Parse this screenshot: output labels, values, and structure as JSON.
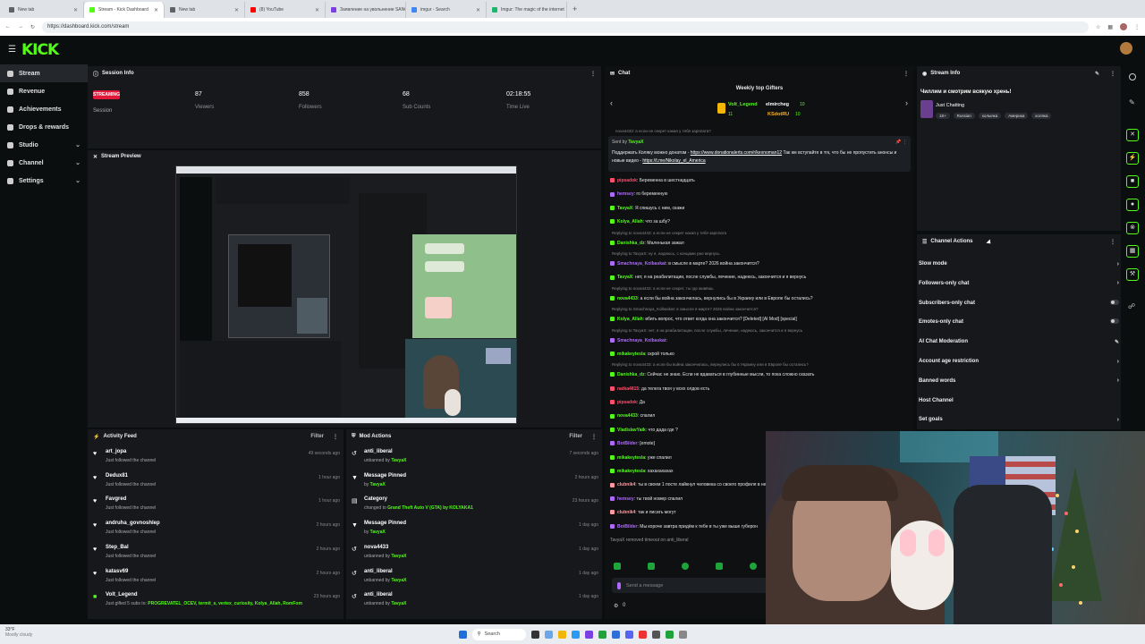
{
  "browser": {
    "tabs": [
      {
        "title": "New tab",
        "color": "#5f6368"
      },
      {
        "title": "Stream - Kick Dashboard",
        "color": "#53fc18",
        "active": true
      },
      {
        "title": "New tab",
        "color": "#5f6368"
      },
      {
        "title": "(8) YouTube",
        "color": "#ff0000"
      },
      {
        "title": "Заявление на увольнение SANG",
        "color": "#7b3fe4"
      },
      {
        "title": "imgur - Search",
        "color": "#4285f4"
      },
      {
        "title": "Imgur: The magic of the internet",
        "color": "#1bb76e"
      }
    ],
    "url": "https://dashboard.kick.com/stream"
  },
  "sidebar": {
    "items": [
      {
        "label": "Stream",
        "active": true
      },
      {
        "label": "Revenue"
      },
      {
        "label": "Achievements"
      },
      {
        "label": "Drops & rewards"
      },
      {
        "label": "Studio",
        "chevron": true
      },
      {
        "label": "Channel",
        "chevron": true
      },
      {
        "label": "Settings",
        "chevron": true
      }
    ]
  },
  "session": {
    "title": "Session Info",
    "streaming_badge": "STREAMING",
    "session_label": "Session",
    "stats": [
      {
        "value": "87",
        "label": "Viewers"
      },
      {
        "value": "858",
        "label": "Followers"
      },
      {
        "value": "68",
        "label": "Sub Counts"
      },
      {
        "value": "02:18:55",
        "label": "Time Live"
      }
    ]
  },
  "preview": {
    "title": "Stream Preview"
  },
  "activity": {
    "title": "Activity Feed",
    "filter": "Filter",
    "items": [
      {
        "name": "art_jopa",
        "sub": "Just followed the channel",
        "time": "49 seconds ago",
        "icon": "heart"
      },
      {
        "name": "Dedux81",
        "sub": "Just followed the channel",
        "time": "1 hour ago",
        "icon": "heart"
      },
      {
        "name": "Favgred",
        "sub": "Just followed the channel",
        "time": "1 hour ago",
        "icon": "heart"
      },
      {
        "name": "andruha_govnoshlep",
        "sub": "Just followed the channel",
        "time": "2 hours ago",
        "icon": "heart"
      },
      {
        "name": "Step_Bal",
        "sub": "Just followed the channel",
        "time": "2 hours ago",
        "icon": "heart"
      },
      {
        "name": "katasv69",
        "sub": "Just followed the channel",
        "time": "2 hours ago",
        "icon": "heart"
      },
      {
        "name": "Volt_Legend",
        "sub_prefix": "Just gifted 5 subs to: ",
        "sub_names": "PROGREVATEL_OCEV, termit_s, vertex_curiosity, Kolya_Allah, RomFom",
        "time": "23 hours ago",
        "icon": "gift"
      }
    ]
  },
  "mod": {
    "title": "Mod Actions",
    "filter": "Filter",
    "items": [
      {
        "name": "anti_liberal",
        "pre": "unbanned by ",
        "by": "TavyaX",
        "time": "7 seconds ago",
        "icon": "ban"
      },
      {
        "name": "Message Pinned",
        "pre": "by ",
        "by": "TavyaX",
        "time": "2 hours ago",
        "icon": "pin"
      },
      {
        "name": "Category",
        "pre": "changed to ",
        "by": "Grand Theft Auto V (GTA) by KOLYAKA1",
        "time": "23 hours ago",
        "icon": "cat"
      },
      {
        "name": "Message Pinned",
        "pre": "by ",
        "by": "TavyaX",
        "time": "1 day ago",
        "icon": "pin"
      },
      {
        "name": "nova4433",
        "pre": "unbanned by ",
        "by": "TavyaX",
        "time": "1 day ago",
        "icon": "ban"
      },
      {
        "name": "anti_liberal",
        "pre": "unbanned by ",
        "by": "TavyaX",
        "time": "1 day ago",
        "icon": "ban"
      },
      {
        "name": "anti_liberal",
        "pre": "unbanned by ",
        "by": "TavyaX",
        "time": "1 day ago",
        "icon": "ban"
      }
    ]
  },
  "chat": {
    "title": "Chat",
    "gifters_title": "Weekly top Gifters",
    "gifters": [
      {
        "name": "Volt_Legend",
        "count": "11"
      },
      {
        "name": "elmircheg",
        "count": "10"
      },
      {
        "name": "KSdotRU",
        "count": "10"
      }
    ],
    "pinned_by_prefix": "Sent by",
    "pinned_by": "TavyaX",
    "pinned_text": "Поддержать Коляку можно донатом - ",
    "pinned_link1": "https://www.donationalerts.com/r/kexnoman12",
    "pinned_text2": " Так же вступайте в тгк, что бы не пропустить анонсы и новые видео - ",
    "pinned_link2": "https://t.me/Nikolay_el_America",
    "top_fragment": "nova4433: а если не секрет какая у тебя зарплата?",
    "messages": [
      {
        "u": "pipsadok",
        "c": "#ff4d6d",
        "m": "Беременна в шестнадцать"
      },
      {
        "u": "hemsey",
        "c": "#b069ff",
        "m": "го беременную"
      },
      {
        "u": "TavyaX",
        "c": "#53fc18",
        "m": "Я спишусь с ним, скажи"
      },
      {
        "u": "Kolya_Allah",
        "c": "#53fc18",
        "m": "что за шбу?"
      },
      {
        "reply": "Replying to nova4433: а если не секрет какая у тебя зарплата"
      },
      {
        "u": "Danishka_dz",
        "c": "#53fc18",
        "m": "Маленькая зажал"
      },
      {
        "reply": "Replying to TavyaX: ну я, надеюсь, с концами уже вернусь"
      },
      {
        "u": "Smachnaya_Kolbaskat",
        "c": "#b069ff",
        "m": "в смысле в марте? 2026 война закончится?"
      },
      {
        "u": "TavyaX",
        "c": "#53fc18",
        "m": "нет, я на реабилитации, после службы, лечение, надеюсь, закончится и я вернусь"
      },
      {
        "reply": "Replying to nova4433: а если не секрет, ты где живёшь"
      },
      {
        "u": "nova4433",
        "c": "#53fc18",
        "m": "а если бы война закончилась, вернулись бы в Украину или в Европе бы остались?"
      },
      {
        "reply": "Replying to Smachnaya_Kolbaskat: в смысле в марте? 2026 война закончится?"
      },
      {
        "u": "Kolya_Allah",
        "c": "#53fc18",
        "m": "вбить вопрос, что ответ когда она закончится? [Deleted] [AI Mod] [special]"
      },
      {
        "reply": "Replying to TavyaX: нет, я на реабилитации, после службы, лечение, надеюсь, закончится и я вернусь"
      },
      {
        "u": "Smachnaya_Kolbaskat",
        "c": "#b069ff",
        "m": ""
      },
      {
        "u": "mikakeytesla",
        "c": "#53fc18",
        "m": "скрой только"
      },
      {
        "reply": "Replying to nova4433: а если бы война закончилась, вернулись бы в Украину или в Европе бы остались?"
      },
      {
        "u": "Danishka_dz",
        "c": "#53fc18",
        "m": "Сейчас не знаю. Если не вдаваться в глубинные мысли, то пока сложно сказать"
      },
      {
        "u": "natka4815",
        "c": "#ff4d6d",
        "m": "да телега твоя у всех олдов есть"
      },
      {
        "u": "pipsadok",
        "c": "#ff4d6d",
        "m": "Да"
      },
      {
        "u": "nova4433",
        "c": "#53fc18",
        "m": "спалил"
      },
      {
        "u": "VladislavYaik",
        "c": "#53fc18",
        "m": "что дада где ?"
      },
      {
        "u": "BotBilder",
        "c": "#b069ff",
        "m": "[emote]"
      },
      {
        "u": "mikakeytesla",
        "c": "#53fc18",
        "m": "уже спалил"
      },
      {
        "u": "mikakeytesla",
        "c": "#53fc18",
        "m": "хахахахахах"
      },
      {
        "u": "clubnik4",
        "c": "#ff9aa2",
        "m": "ты в своем 1 посте лайкнул человека со своего профиля в не с"
      },
      {
        "u": "hemsey",
        "c": "#b069ff",
        "m": "ты твой номер спалил"
      },
      {
        "u": "clubnik4",
        "c": "#ff9aa2",
        "m": "так и писать могут"
      },
      {
        "u": "BotBilder",
        "c": "#b069ff",
        "m": "Мы короче завтра придём к тебе в ты уже выше губерон"
      },
      {
        "system": "TavyaX removed timeout on anti_liberal"
      }
    ],
    "input_placeholder": "Send a message",
    "counter": "0"
  },
  "stream_info": {
    "title": "Stream Info",
    "stream_title": "Чиллим и смотрим всякую хрень!",
    "category": "Just Chatting",
    "tags": [
      "18+",
      "Russian",
      "колыяка",
      "Америка",
      "коляка"
    ]
  },
  "channel_actions": {
    "title": "Channel Actions",
    "items": [
      {
        "label": "Slow mode",
        "ctrl": "arrow"
      },
      {
        "label": "Followers-only chat",
        "ctrl": "arrow"
      },
      {
        "label": "Subscribers-only chat",
        "ctrl": "toggle"
      },
      {
        "label": "Emotes-only chat",
        "ctrl": "toggle"
      },
      {
        "label": "AI Chat Moderation",
        "ctrl": "edit"
      },
      {
        "label": "Account age restriction",
        "ctrl": "arrow"
      },
      {
        "label": "Banned words",
        "ctrl": "arrow"
      },
      {
        "label": "Host Channel",
        "ctrl": "none"
      },
      {
        "label": "Set goals",
        "ctrl": "arrow"
      }
    ]
  },
  "weather": {
    "temp": "33°F",
    "desc": "Mostly cloudy"
  },
  "taskbar": {
    "search": "Search"
  }
}
